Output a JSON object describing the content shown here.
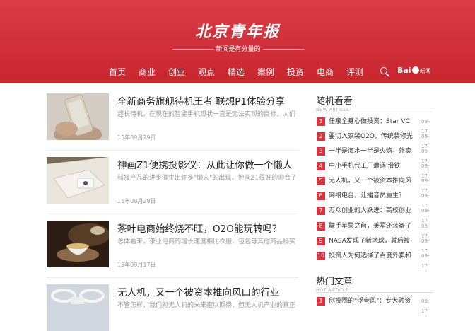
{
  "header": {
    "logo": "北京青年报",
    "slogan": "新闻是有分量的",
    "nav": [
      "首页",
      "商业",
      "创业",
      "观点",
      "精选",
      "案例",
      "投资",
      "电商",
      "评测"
    ],
    "baidu_logo": "Bai",
    "baidu_suffix": "新闻",
    "brand_color": "#c9252f"
  },
  "articles": [
    {
      "title": "全新商务旗舰待机王者 联想P1体验分享",
      "summary": "超长待机，在现在的智能手机现状一直是无法实现的目标，人们",
      "date": "15年09月29日"
    },
    {
      "title": "神画Z1便携投影仪：从此让你做一个懒人",
      "summary": "科技产品的进步催生出许多\"懒人\"的出现，神画Z1很好的迎合了",
      "date": "15年09月28日"
    },
    {
      "title": "茶叶电商始终烧不旺，O2O能玩转吗？",
      "summary": "总体看来，茶业电商的增长速度相比衣服、包包等其他商品稍实",
      "date": "15年09月17日"
    },
    {
      "title": "无人机，又一个被资本推向风口的行业",
      "summary": "不管怎样，我们对无人机的未来抱以期待，但无人机产业的真正",
      "date": ""
    }
  ],
  "sidebar": {
    "random": {
      "title": "随机看看",
      "subtitle": "NEW ARTICLE",
      "items": [
        {
          "num": "1",
          "text": "任泉全身心做投资：Star VC",
          "date": "09-17"
        },
        {
          "num": "2",
          "text": "要切入家装O2O，传统装修光",
          "date": "09-17"
        },
        {
          "num": "3",
          "text": "一半是海水一半是火焰，外卖",
          "date": "09-17"
        },
        {
          "num": "4",
          "text": "中小手机代工厂遭遇'滑铁",
          "date": "09-17"
        },
        {
          "num": "5",
          "text": "无人机，又一个被资本推向风",
          "date": "09-17"
        },
        {
          "num": "6",
          "text": "网络电台，让播音员重生？",
          "date": "09-17"
        },
        {
          "num": "7",
          "text": "万众创业的大跃进：高校创业",
          "date": "09-17"
        },
        {
          "num": "8",
          "text": "联手苹果之前，美军还装备了",
          "date": "09-17"
        },
        {
          "num": "9",
          "text": "NASA发现了新地球，就后被",
          "date": "09-17"
        },
        {
          "num": "10",
          "text": "投资人为何选择了百度外卖和",
          "date": "09-17"
        }
      ]
    },
    "hot": {
      "title": "热门文章",
      "subtitle": "HOT ARTICLE",
      "items": [
        {
          "num": "1",
          "text": "创投圈的\"浮夸风\"：专大融资",
          "date": "09-17"
        }
      ]
    }
  }
}
